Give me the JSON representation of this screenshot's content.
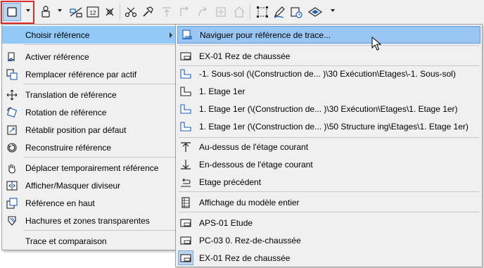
{
  "toolbar": {
    "icons": [
      "reference-frame-icon",
      "layer-figure-icon",
      "compare-levels-icon",
      "level-12-icon",
      "crosshair-icon",
      "scissors-icon",
      "pick-hammer-icon",
      "align-up-icon",
      "corner-icon",
      "rotate-arrow-icon",
      "grid-add-icon",
      "house-icon",
      "select-frame-icon",
      "pen-icon",
      "cloud-user-icon",
      "layers-eye-icon"
    ],
    "level_label": "12"
  },
  "main_menu": {
    "items": [
      {
        "label": "Choisir référence",
        "icon": "none"
      },
      {
        "label": "Activer référence",
        "icon": "bookmark-icon"
      },
      {
        "label": "Remplacer référence par actif",
        "icon": "replace-icon"
      },
      {
        "label": "Translation de référence",
        "icon": "move-icon"
      },
      {
        "label": "Rotation de référence",
        "icon": "rotate-icon"
      },
      {
        "label": "Rétablir position par défaut",
        "icon": "reset-position-icon"
      },
      {
        "label": "Reconstruire référence",
        "icon": "rebuild-icon"
      },
      {
        "label": "Déplacer temporairement référence",
        "icon": "hand-icon"
      },
      {
        "label": "Afficher/Masquer diviseur",
        "icon": "divider-icon"
      },
      {
        "label": "Référence en haut",
        "icon": "reference-top-icon"
      },
      {
        "label": "Hachures et zones transparentes",
        "icon": "hatch-icon"
      },
      {
        "label": "Trace et comparaison",
        "icon": "checkbox-icon"
      }
    ]
  },
  "sub_menu": {
    "items": [
      {
        "label": "Naviguer pour référence de trace...",
        "icon": "navigator-icon"
      },
      {
        "label": "EX-01 Rez de chaussée",
        "icon": "layout-icon"
      },
      {
        "label": "-1. Sous-sol (\\(Construction de... )\\30 Exécution\\Etages\\-1. Sous-sol)",
        "icon": "story-icon"
      },
      {
        "label": "1. Etage 1er",
        "icon": "story-icon"
      },
      {
        "label": "1. Etage 1er (\\(Construction de... )\\30 Exécution\\Etages\\1. Etage 1er)",
        "icon": "story-icon"
      },
      {
        "label": "1. Etage 1er (\\(Construction de... )\\50 Structure ing\\Etages\\1. Etage 1er)",
        "icon": "story-icon"
      },
      {
        "label": "Au-dessus de l'étage courant",
        "icon": "arrow-up-icon"
      },
      {
        "label": "En-dessous de l'étage courant",
        "icon": "arrow-down-icon"
      },
      {
        "label": "Etage précédent",
        "icon": "previous-icon"
      },
      {
        "label": "Affichage du modèle entier",
        "icon": "model-icon"
      },
      {
        "label": "APS-01 Etude",
        "icon": "layout-icon"
      },
      {
        "label": "PC-03 0. Rez-de-chaussée",
        "icon": "layout-icon"
      },
      {
        "label": "EX-01 Rez de chaussée",
        "icon": "layout-icon"
      }
    ]
  },
  "colors": {
    "highlight": "#91c9f7",
    "active_border": "#e02a2a",
    "menu_bg": "#f0f0f0"
  }
}
